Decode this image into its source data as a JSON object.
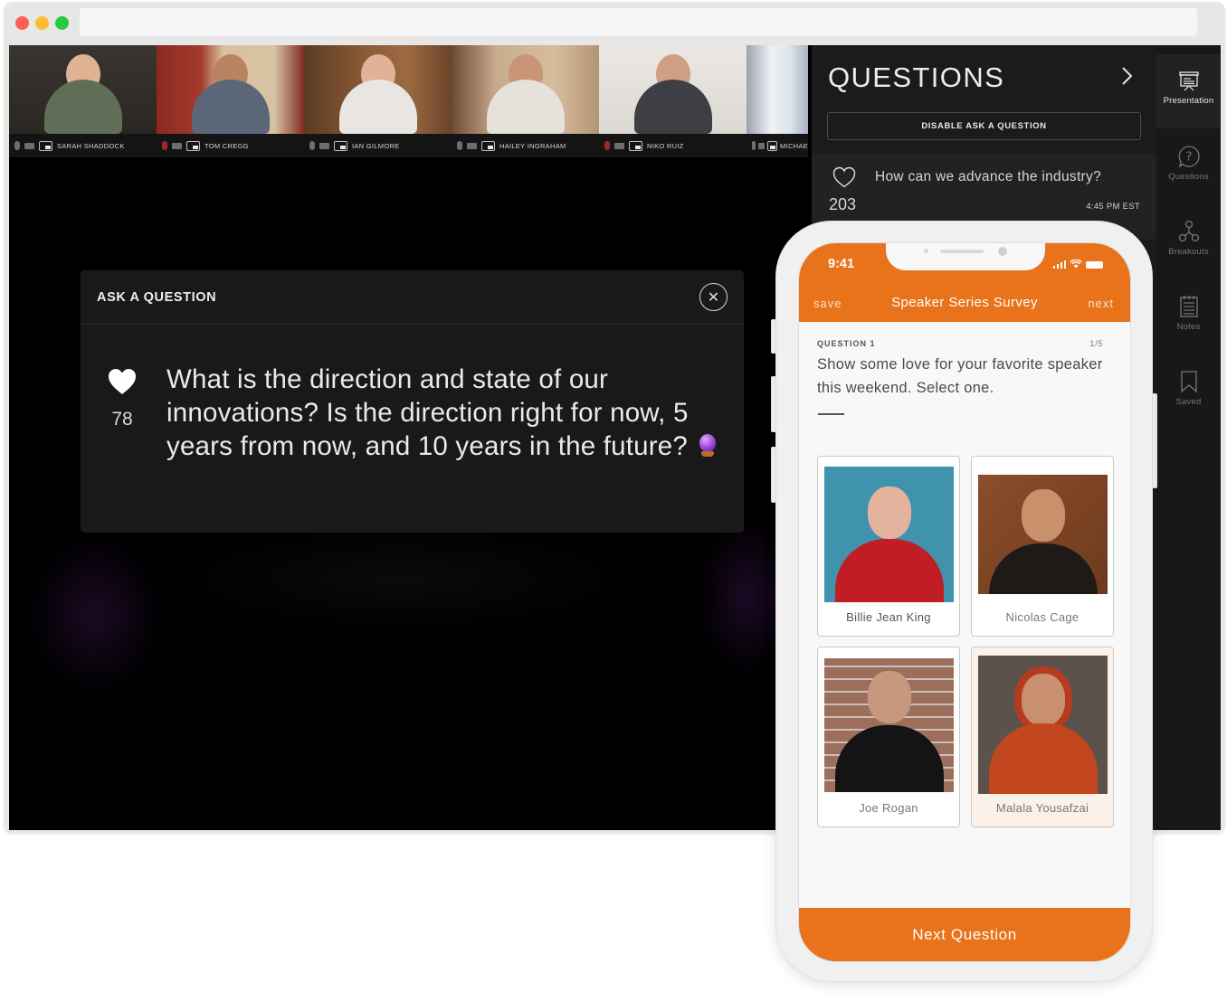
{
  "browser": {
    "url": ""
  },
  "video_strip": {
    "participants": [
      {
        "name": "SARAH SHADDOCK",
        "muted": false
      },
      {
        "name": "TOM CREGG",
        "muted": true
      },
      {
        "name": "IAN GILMORE",
        "muted": false
      },
      {
        "name": "HAILEY INGRAHAM",
        "muted": false
      },
      {
        "name": "NIKO RUIZ",
        "muted": true
      },
      {
        "name": "MICHAE",
        "muted": false
      }
    ]
  },
  "ask_modal": {
    "title": "ASK A QUESTION",
    "close_icon": "close-icon",
    "likes": "78",
    "question": "What is the direction and state of our innovations? Is the direction right for now, 5 years from now, and 10 years in the future?",
    "emoji": "crystal-ball"
  },
  "questions_panel": {
    "title": "QUESTIONS",
    "disable_button": "DISABLE ASK A QUESTION",
    "items": [
      {
        "text": "How can we advance the industry?",
        "likes": "203",
        "time": "4:45 PM EST"
      }
    ]
  },
  "nav_rail": {
    "items": [
      {
        "label": "Presentation",
        "icon": "presentation-icon",
        "active": true
      },
      {
        "label": "Questions",
        "icon": "question-bubble-icon",
        "active": false
      },
      {
        "label": "Breakouts",
        "icon": "breakouts-icon",
        "active": false
      },
      {
        "label": "Notes",
        "icon": "notes-icon",
        "active": false
      },
      {
        "label": "Saved",
        "icon": "bookmark-icon",
        "active": false
      }
    ]
  },
  "phone": {
    "status_time": "9:41",
    "header": {
      "save": "save",
      "title": "Speaker Series Survey",
      "next": "next"
    },
    "question_label": "QUESTION 1",
    "progress": "1/5",
    "prompt": "Show some love for your favorite speaker this weekend. Select one.",
    "options": [
      {
        "name": "Billie Jean King",
        "selected": false
      },
      {
        "name": "Nicolas Cage",
        "selected": false
      },
      {
        "name": "Joe Rogan",
        "selected": false
      },
      {
        "name": "Malala Yousafzai",
        "selected": true
      }
    ],
    "next_button": "Next Question"
  },
  "colors": {
    "accent": "#e8731b",
    "panel_bg": "#1b1b1b",
    "modal_bg": "#191919",
    "selected_card": "#fbf1e8"
  }
}
